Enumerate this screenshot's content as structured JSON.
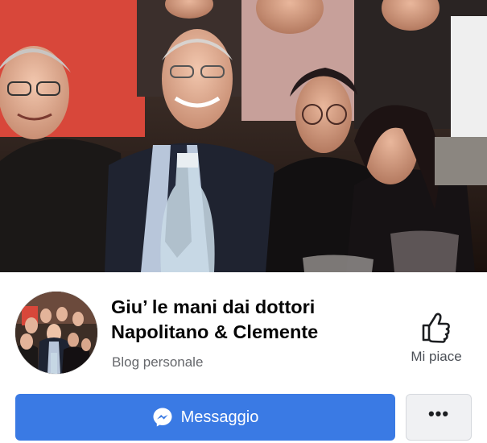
{
  "page": {
    "name_line1": "Giu’ le mani dai dottori",
    "name_line2": "Napolitano & Clemente",
    "category": "Blog personale"
  },
  "actions": {
    "like_label": "Mi piace",
    "message_label": "Messaggio",
    "more_label": "•••"
  },
  "images": {
    "cover_alt": "cover-photo-group",
    "avatar_alt": "profile-picture-group"
  },
  "colors": {
    "message_button": "#3a7ae4",
    "more_button": "#f0f1f3",
    "text_primary": "#050505",
    "text_secondary": "#65676b"
  }
}
